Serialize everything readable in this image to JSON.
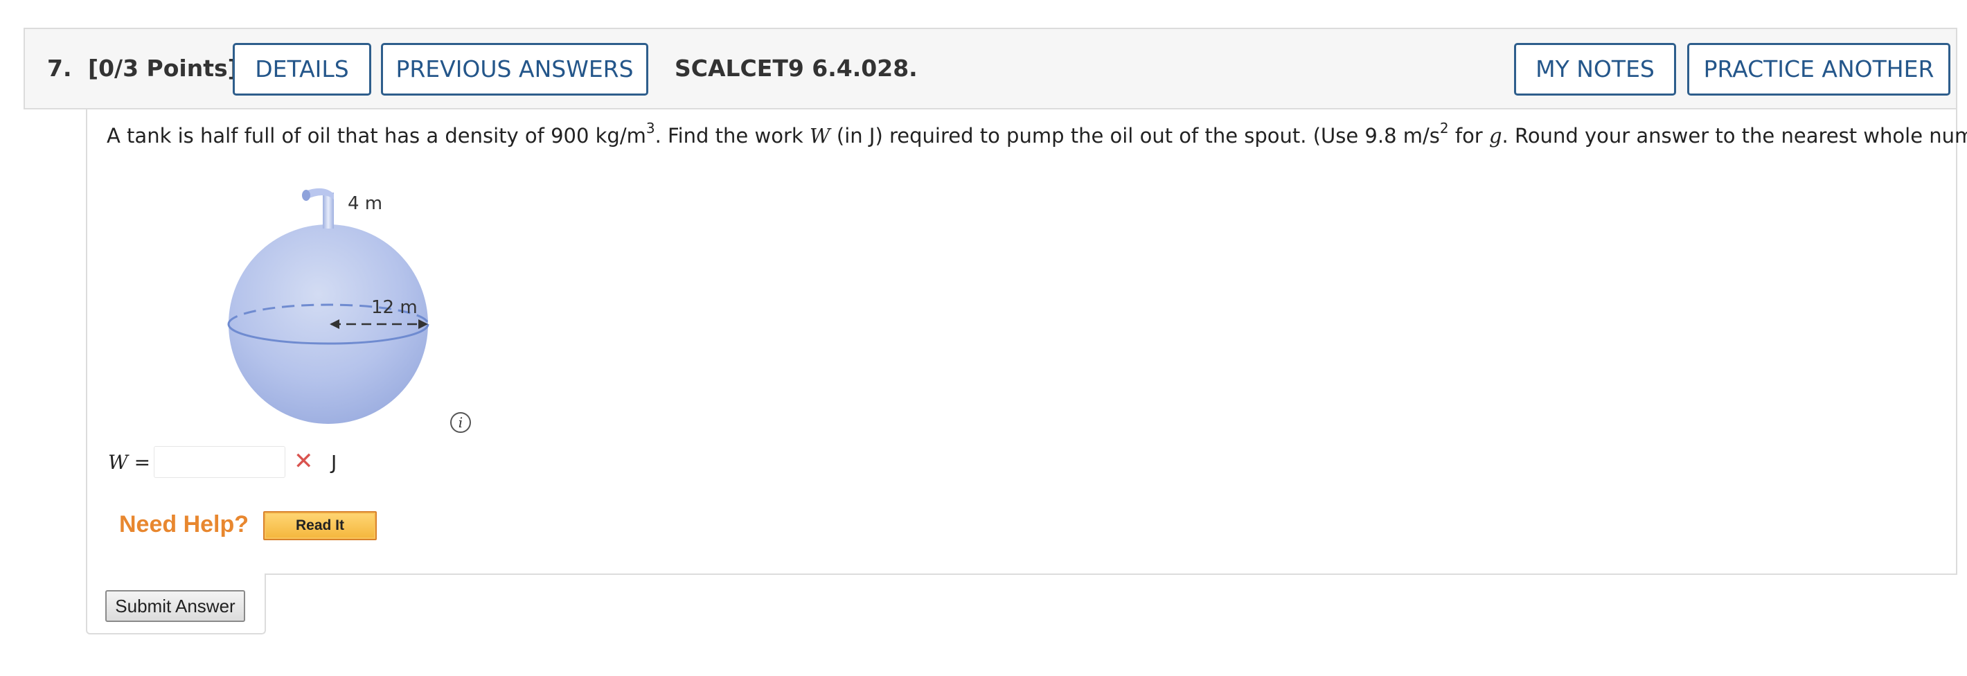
{
  "header": {
    "question_number": "7.",
    "points": "[0/3 Points]",
    "details_label": "DETAILS",
    "previous_answers_label": "PREVIOUS ANSWERS",
    "problem_code": "SCALCET9 6.4.028.",
    "my_notes_label": "MY NOTES",
    "practice_another_label": "PRACTICE ANOTHER"
  },
  "question": {
    "text_1": "A tank is half full of oil that has a density of 900 kg/m",
    "sup_1": "3",
    "text_2": ". Find the work ",
    "var_w": "W",
    "text_3": " (in J) required to pump the oil out of the spout. (Use 9.8 m/s",
    "sup_2": "2",
    "text_4": " for ",
    "var_g": "g",
    "text_5": ". Round your answer to the nearest whole number.)"
  },
  "figure": {
    "spout_label": "4 m",
    "radius_label": "12 m",
    "info_icon": "info-icon",
    "colors": {
      "sphere_light": "#c8d3ef",
      "sphere_dark": "#9aacdf",
      "outline": "#6f8bd0"
    }
  },
  "answer": {
    "label": "W =",
    "value": "",
    "status_icon": "x-mark-icon",
    "status_color": "#d9534f",
    "unit": "J"
  },
  "help": {
    "need_help_label": "Need Help?",
    "read_it_label": "Read It"
  },
  "submit": {
    "label": "Submit Answer"
  }
}
